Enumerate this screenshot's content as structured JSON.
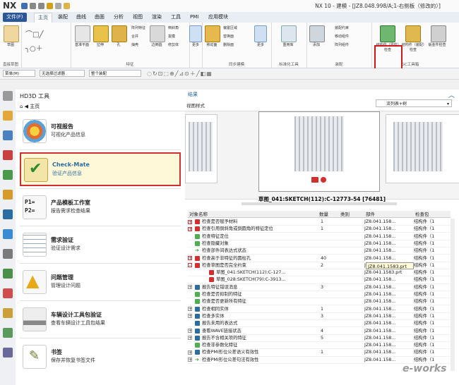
{
  "app": {
    "logo": "NX",
    "window_title": "NX 10 - 建模 - [JZ8.048.998/A;1-右侧板（修改的）]"
  },
  "menu": {
    "tabs": [
      "文件(F)",
      "主页",
      "装配",
      "曲线",
      "曲面",
      "分析",
      "视图",
      "渲染",
      "工具",
      "PMI",
      "应用模块"
    ]
  },
  "ribbon": {
    "groups": [
      {
        "name": "直接草图",
        "buttons": [
          "草图"
        ]
      },
      {
        "name": "特征",
        "buttons": [
          "基准平面",
          "拉伸",
          "孔",
          "阵列特征",
          "合并",
          "抽壳",
          "边倒圆",
          "倒斜角",
          "拔模",
          "修剪体",
          "更多"
        ]
      },
      {
        "name": "同步建模",
        "buttons": [
          "移动面",
          "偏置区域",
          "替换面",
          "删除面",
          "更多"
        ]
      },
      {
        "name": "标准化工具",
        "buttons": [
          "重用库"
        ]
      },
      {
        "name": "装配",
        "buttons": [
          "添加",
          "装配约束",
          "移动组件",
          "阵列组件"
        ]
      },
      {
        "name": "GC工具箱",
        "buttons": [
          "结构件（零件）检查",
          "结构件（装配）检查",
          "钣金件检查"
        ]
      }
    ]
  },
  "toolbar": {
    "menu_label": "菜单(M)",
    "filter": "无选择过滤器",
    "assembly": "整个装配"
  },
  "panel": {
    "title": "HD3D 工具",
    "home": "主页",
    "items": [
      {
        "title": "可视报告",
        "desc": "可视化产品信息"
      },
      {
        "title": "Check-Mate",
        "desc": "验证产品信息"
      },
      {
        "title": "产品模板工作室",
        "desc": "报告需求检查结果"
      },
      {
        "title": "需求验证",
        "desc": "验证设计需求"
      },
      {
        "title": "问题管理",
        "desc": "管理设计问题"
      },
      {
        "title": "车辆设计工具包验证",
        "desc": "查看车辆设计工具包结果"
      },
      {
        "title": "书签",
        "desc": "保存并恢复书签文件"
      }
    ],
    "p_tags": [
      "P1=",
      "P2="
    ]
  },
  "results": {
    "title": "结果",
    "view_style": "视图样式",
    "view_select": "流列表+树",
    "caption": "草图_041:SKETCH(112):C-12773-54 [76481]",
    "columns": [
      "对象名称",
      "数量",
      "类别",
      "部件",
      "检查包"
    ],
    "rows": [
      {
        "name": "检查是否赋予材料",
        "qty": "1",
        "part": "JZ8.041.158...",
        "pkg": "结构件（1",
        "state": "fail",
        "exp": "+"
      },
      {
        "name": "检查引用倒斜角或倒圆角的特征定位",
        "qty": "1",
        "part": "JZ8.041.158...",
        "pkg": "结构件（1",
        "state": "fail",
        "exp": "+"
      },
      {
        "name": "检查特征定位",
        "qty": "",
        "part": "JZ8.041.158...",
        "pkg": "结构件（1",
        "state": "pass",
        "exp": ""
      },
      {
        "name": "检查隐藏对象",
        "qty": "",
        "part": "JZ8.041.158...",
        "pkg": "结构件（1",
        "state": "pass",
        "exp": ""
      },
      {
        "name": "检查部件间表达式状态",
        "qty": "",
        "part": "JZ8.041.158...",
        "pkg": "结构件（1",
        "state": "arrow",
        "exp": ""
      },
      {
        "name": "检查高于非特征的圆柱孔",
        "qty": "40",
        "part": "JZ8.041.158...",
        "pkg": "结构件（1",
        "state": "fail",
        "exp": "+"
      },
      {
        "name": "检查草图是否完全约束",
        "qty": "2",
        "part": "JZ8.041.158...",
        "pkg": "结构件（1",
        "state": "fail",
        "exp": "-"
      },
      {
        "name": "草图_041:SKETCH(112):C-127...",
        "qty": "",
        "part": "JZ8.041.1583.prt",
        "pkg": "结构件（1",
        "state": "fail",
        "exp": "",
        "child": true
      },
      {
        "name": "草图_028:SKETCH(79):C-3913...",
        "qty": "",
        "part": "JZ8.041.158...",
        "pkg": "结构件（1",
        "state": "fail",
        "exp": "",
        "child": true
      },
      {
        "name": "报告特征错误消息",
        "qty": "3",
        "part": "JZ8.041.158...",
        "pkg": "结构件（1",
        "state": "info",
        "exp": "+"
      },
      {
        "name": "检查是否抑制的特征",
        "qty": "",
        "part": "JZ8.041.158...",
        "pkg": "结构件（1",
        "state": "pass",
        "exp": ""
      },
      {
        "name": "检查是否更新所有特征",
        "qty": "",
        "part": "JZ8.041.158...",
        "pkg": "结构件（1",
        "state": "pass",
        "exp": ""
      },
      {
        "name": "检查相同实体",
        "qty": "1",
        "part": "JZ8.041.158...",
        "pkg": "结构件（1",
        "state": "info",
        "exp": "+"
      },
      {
        "name": "检查多实体",
        "qty": "3",
        "part": "JZ8.041.158...",
        "pkg": "结构件（1",
        "state": "info",
        "exp": "+"
      },
      {
        "name": "报告未用的表达式",
        "qty": "",
        "part": "JZ8.041.158...",
        "pkg": "结构件（1",
        "state": "info",
        "exp": ""
      },
      {
        "name": "查看WAVE链接状态",
        "qty": "4",
        "part": "JZ8.041.158...",
        "pkg": "结构件（1",
        "state": "info",
        "exp": "+"
      },
      {
        "name": "报告不含相关项的特征",
        "qty": "5",
        "part": "JZ8.041.158...",
        "pkg": "结构件（1",
        "state": "info",
        "exp": "+"
      },
      {
        "name": "检查非参数化特征",
        "qty": "",
        "part": "JZ8.041.158...",
        "pkg": "结构件（1",
        "state": "pass",
        "exp": ""
      },
      {
        "name": "检查PMI形位公差语义有效性",
        "qty": "1",
        "part": "JZ8.041.158...",
        "pkg": "结构件（1",
        "state": "info",
        "exp": "+"
      },
      {
        "name": "检查PMI形位公差句法有效性",
        "qty": "",
        "part": "JZ8.041.158...",
        "pkg": "结构件（1",
        "state": "arrow",
        "exp": "+"
      }
    ],
    "tooltip": "JZ8.041.1583.prt"
  },
  "watermark": "e-works",
  "colors": {
    "fail": "#d32f2f",
    "pass": "#4caf50",
    "info": "#2b6ca3",
    "arrow": "#2e9c2e",
    "accent": "#2b5797",
    "highlight": "#d01818"
  }
}
